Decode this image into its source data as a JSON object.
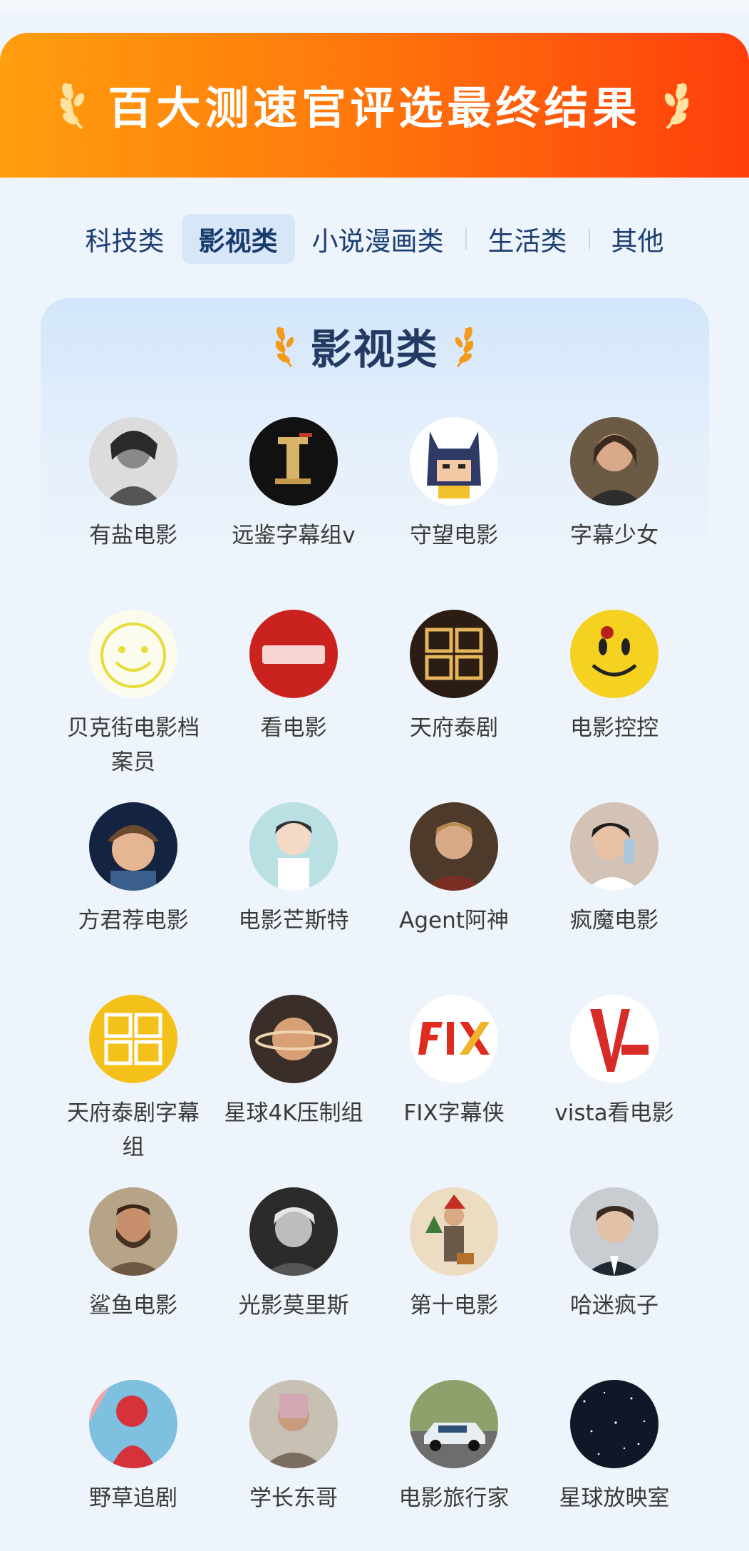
{
  "banner": {
    "title": "百大测速官评选最终结果"
  },
  "tabs": [
    {
      "label": "科技类",
      "active": false
    },
    {
      "label": "影视类",
      "active": true
    },
    {
      "label": "小说漫画类",
      "active": false
    },
    {
      "label": "生活类",
      "active": false
    },
    {
      "label": "其他",
      "active": false
    }
  ],
  "section": {
    "title": "影视类"
  },
  "accounts": [
    {
      "name": "有盐电影",
      "icon": "bw-woman-portrait"
    },
    {
      "name": "远鉴字幕组v",
      "icon": "gold-camera-figure"
    },
    {
      "name": "守望电影",
      "icon": "batman-cartoon"
    },
    {
      "name": "字幕少女",
      "icon": "woman-portrait"
    },
    {
      "name": "贝克街电影档案员",
      "icon": "smiley-face"
    },
    {
      "name": "看电影",
      "icon": "red-text-logo"
    },
    {
      "name": "天府泰剧",
      "icon": "tianfu-logo-dark"
    },
    {
      "name": "电影控控",
      "icon": "watchmen-smiley"
    },
    {
      "name": "方君荐电影",
      "icon": "cartoon-boy"
    },
    {
      "name": "电影芒斯特",
      "icon": "cartoon-man"
    },
    {
      "name": "Agent阿神",
      "icon": "man-portrait"
    },
    {
      "name": "疯魔电影",
      "icon": "woman-phone"
    },
    {
      "name": "天府泰剧字幕组",
      "icon": "tianfu-logo-yellow"
    },
    {
      "name": "星球4K压制组",
      "icon": "planet-saturn"
    },
    {
      "name": "FIX字幕侠",
      "icon": "fix-logo"
    },
    {
      "name": "vista看电影",
      "icon": "vista-logo"
    },
    {
      "name": "鲨鱼电影",
      "icon": "bearded-man"
    },
    {
      "name": "光影莫里斯",
      "icon": "bw-man-portrait"
    },
    {
      "name": "第十电影",
      "icon": "christmas-man"
    },
    {
      "name": "哈迷疯子",
      "icon": "young-man-portrait"
    },
    {
      "name": "野草追剧",
      "icon": "red-figure-art"
    },
    {
      "name": "学长东哥",
      "icon": "man-phone-selfie"
    },
    {
      "name": "电影旅行家",
      "icon": "race-car"
    },
    {
      "name": "星球放映室",
      "icon": "starry-night"
    }
  ]
}
